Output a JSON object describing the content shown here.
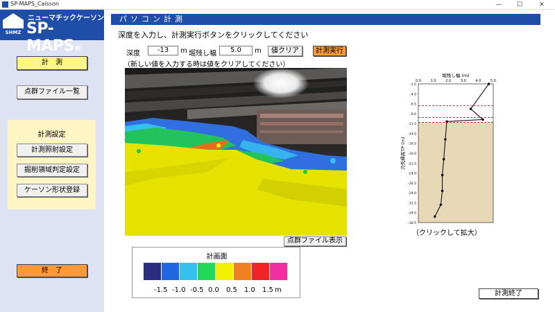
{
  "window": {
    "title": "SP-MAPS_Caisson",
    "minimize": "—",
    "maximize": "☐",
    "close": "✕"
  },
  "logo": {
    "subtitle": "ニューマチックケーソン",
    "name": "SP-MAPS",
    "registered": "®",
    "company": "SHMZ"
  },
  "sidebar": {
    "measure_label": "計　測",
    "pointcloud_list_label": "点群ファイル一覧",
    "settings_header": "計測設定",
    "settings_buttons": [
      "計測照射設定",
      "掘削領域判定設定",
      "ケーソン形状登録"
    ],
    "exit_label": "終　了"
  },
  "main": {
    "header": "パソコン計測",
    "instruction": "深度を入力し、計測実行ボタンをクリックしてください",
    "depth_label": "深度",
    "depth_value": "-13",
    "depth_unit": "m",
    "remain_label": "堀残し幅",
    "remain_value": "5.0",
    "remain_unit": "m",
    "clear_label": "値クリア",
    "execute_label": "計測実行",
    "note": "（新しい値を入力する時は値をクリアしてください）",
    "pointcloud_show_label": "点群ファイル表示",
    "click_enlarge": "（クリックして拡大）",
    "end_measure_label": "計測終了"
  },
  "legend": {
    "title": "計画面",
    "colors": [
      "#2b2b7f",
      "#1f66e0",
      "#35c0f0",
      "#22d95a",
      "#f2f200",
      "#f08020",
      "#f02424",
      "#f22fa0"
    ],
    "ticks": [
      "-1.5",
      "-1.0",
      "-0.5",
      "0.0",
      "0.5",
      "1.0",
      "1.5"
    ],
    "unit": "m"
  },
  "chart_data": {
    "type": "line",
    "title": "堀残し幅 (m)",
    "ylabel": "刃先標高TP (m)",
    "xlim": [
      0,
      5.0
    ],
    "ylim": [
      -36.5,
      -1.5
    ],
    "xticks": [
      "0.0",
      "1.0",
      "2.0",
      "3.0",
      "4.0",
      "5.0"
    ],
    "yticks": [
      "-1.5",
      "-4.0",
      "-6.5",
      "-9.0",
      "-11.5",
      "-14.0",
      "-16.5",
      "-19.0",
      "-21.5",
      "-24.0",
      "-26.5",
      "-29.0",
      "-31.5",
      "-34.0",
      "-36.5"
    ],
    "series": [
      {
        "x": [
          4.7,
          3.5,
          4.3,
          1.9,
          1.8,
          1.7,
          1.6,
          1.6,
          1.5,
          1.1
        ],
        "y": [
          -1.5,
          -7.8,
          -10.5,
          -11.0,
          -15.5,
          -20.5,
          -24.5,
          -28.5,
          -32.0,
          -35.0
        ]
      }
    ],
    "ref_lines": [
      -7.0,
      -10.0,
      -11.2
    ],
    "fill_below": -11.2
  }
}
